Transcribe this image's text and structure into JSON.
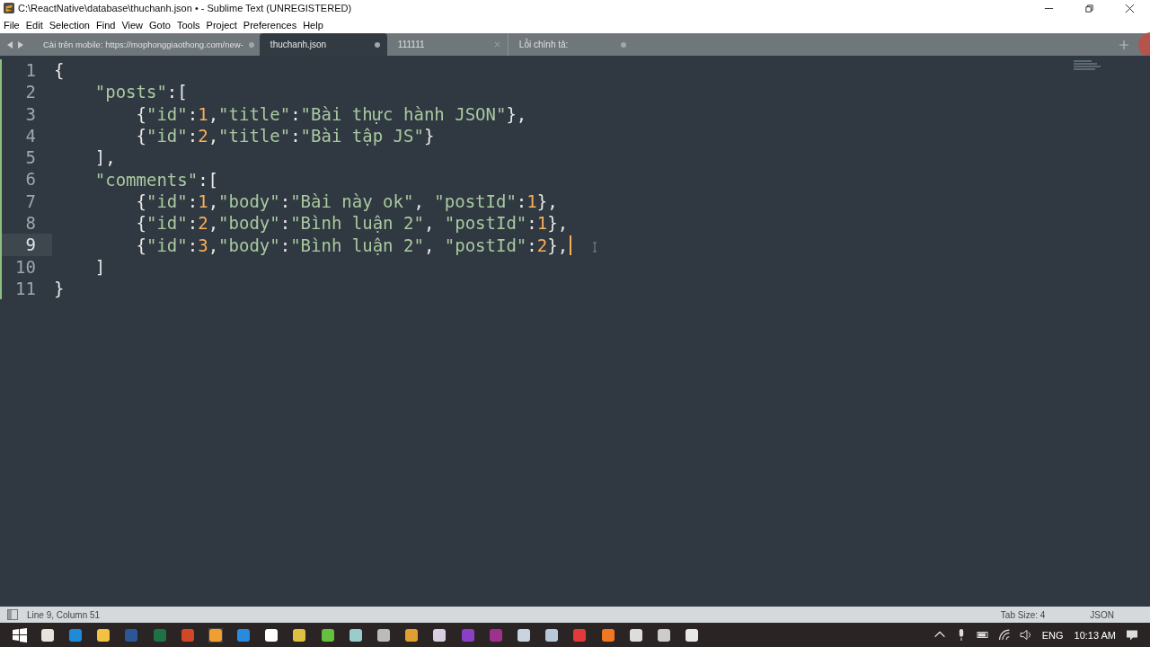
{
  "window": {
    "title": "C:\\ReactNative\\database\\thuchanh.json • - Sublime Text (UNREGISTERED)"
  },
  "menu": [
    {
      "label": "File",
      "selected": false
    },
    {
      "label": "Edit",
      "selected": false
    },
    {
      "label": "Selection",
      "selected": false
    },
    {
      "label": "Find",
      "selected": false
    },
    {
      "label": "View",
      "selected": false
    },
    {
      "label": "Goto",
      "selected": false
    },
    {
      "label": "Tools",
      "selected": false
    },
    {
      "label": "Project",
      "selected": false
    },
    {
      "label": "Preferences",
      "selected": false
    },
    {
      "label": "Help",
      "selected": false
    }
  ],
  "tabs": [
    {
      "label": "Cài trên mobile: https://mophonggiaothong.com/new-",
      "selected": false,
      "modified": true
    },
    {
      "label": "thuchanh.json",
      "selected": true,
      "modified": true
    },
    {
      "label": "111111",
      "selected": false,
      "modified": false
    },
    {
      "label": "Lỗi chính tả:",
      "selected": false,
      "modified": true
    }
  ],
  "editor": {
    "lines": [
      {
        "number": "1",
        "current": false,
        "tokens": [
          {
            "kind": "punct",
            "text": "{"
          }
        ]
      },
      {
        "number": "2",
        "current": false,
        "tokens": [
          {
            "kind": "string",
            "text": "    \"posts\""
          },
          {
            "kind": "punct",
            "text": ":["
          }
        ]
      },
      {
        "number": "3",
        "current": false,
        "tokens": [
          {
            "kind": "punct",
            "text": "        {"
          },
          {
            "kind": "string",
            "text": "\"id\""
          },
          {
            "kind": "punct",
            "text": ":"
          },
          {
            "kind": "number",
            "text": "1"
          },
          {
            "kind": "punct",
            "text": ","
          },
          {
            "kind": "string",
            "text": "\"title\""
          },
          {
            "kind": "punct",
            "text": ":"
          },
          {
            "kind": "string",
            "text": "\"Bài thực hành JSON\""
          },
          {
            "kind": "punct",
            "text": "},"
          }
        ]
      },
      {
        "number": "4",
        "current": false,
        "tokens": [
          {
            "kind": "punct",
            "text": "        {"
          },
          {
            "kind": "string",
            "text": "\"id\""
          },
          {
            "kind": "punct",
            "text": ":"
          },
          {
            "kind": "number",
            "text": "2"
          },
          {
            "kind": "punct",
            "text": ","
          },
          {
            "kind": "string",
            "text": "\"title\""
          },
          {
            "kind": "punct",
            "text": ":"
          },
          {
            "kind": "string",
            "text": "\"Bài tập JS\""
          },
          {
            "kind": "punct",
            "text": "}"
          }
        ]
      },
      {
        "number": "5",
        "current": false,
        "tokens": [
          {
            "kind": "punct",
            "text": "    ],"
          }
        ]
      },
      {
        "number": "6",
        "current": false,
        "tokens": [
          {
            "kind": "string",
            "text": "    \"comments\""
          },
          {
            "kind": "punct",
            "text": ":["
          }
        ]
      },
      {
        "number": "7",
        "current": false,
        "tokens": [
          {
            "kind": "punct",
            "text": "        {"
          },
          {
            "kind": "string",
            "text": "\"id\""
          },
          {
            "kind": "punct",
            "text": ":"
          },
          {
            "kind": "number",
            "text": "1"
          },
          {
            "kind": "punct",
            "text": ","
          },
          {
            "kind": "string",
            "text": "\"body\""
          },
          {
            "kind": "punct",
            "text": ":"
          },
          {
            "kind": "string",
            "text": "\"Bài này ok\""
          },
          {
            "kind": "punct",
            "text": ", "
          },
          {
            "kind": "string",
            "text": "\"postId\""
          },
          {
            "kind": "punct",
            "text": ":"
          },
          {
            "kind": "number",
            "text": "1"
          },
          {
            "kind": "punct",
            "text": "},"
          }
        ]
      },
      {
        "number": "8",
        "current": false,
        "tokens": [
          {
            "kind": "punct",
            "text": "        {"
          },
          {
            "kind": "string",
            "text": "\"id\""
          },
          {
            "kind": "punct",
            "text": ":"
          },
          {
            "kind": "number",
            "text": "2"
          },
          {
            "kind": "punct",
            "text": ","
          },
          {
            "kind": "string",
            "text": "\"body\""
          },
          {
            "kind": "punct",
            "text": ":"
          },
          {
            "kind": "string",
            "text": "\"Bình luận 2\""
          },
          {
            "kind": "punct",
            "text": ", "
          },
          {
            "kind": "string",
            "text": "\"postId\""
          },
          {
            "kind": "punct",
            "text": ":"
          },
          {
            "kind": "number",
            "text": "1"
          },
          {
            "kind": "punct",
            "text": "},"
          }
        ]
      },
      {
        "number": "9",
        "current": true,
        "tokens": [
          {
            "kind": "punct",
            "text": "        {"
          },
          {
            "kind": "string",
            "text": "\"id\""
          },
          {
            "kind": "punct",
            "text": ":"
          },
          {
            "kind": "number",
            "text": "3"
          },
          {
            "kind": "punct",
            "text": ","
          },
          {
            "kind": "string",
            "text": "\"body\""
          },
          {
            "kind": "punct",
            "text": ":"
          },
          {
            "kind": "string",
            "text": "\"Bình luận 2\""
          },
          {
            "kind": "punct",
            "text": ", "
          },
          {
            "kind": "string",
            "text": "\"postId\""
          },
          {
            "kind": "punct",
            "text": ":"
          },
          {
            "kind": "number",
            "text": "2"
          },
          {
            "kind": "punct",
            "text": "},"
          }
        ]
      },
      {
        "number": "10",
        "current": false,
        "tokens": [
          {
            "kind": "punct",
            "text": "    ]"
          }
        ]
      },
      {
        "number": "11",
        "current": false,
        "tokens": [
          {
            "kind": "punct",
            "text": "}"
          }
        ]
      }
    ]
  },
  "status_bar": {
    "position": "Line 9, Column 51",
    "tab_size": "Tab Size: 4",
    "syntax": "JSON"
  },
  "taskbar": {
    "language": "ENG",
    "time": "10:13 AM"
  }
}
